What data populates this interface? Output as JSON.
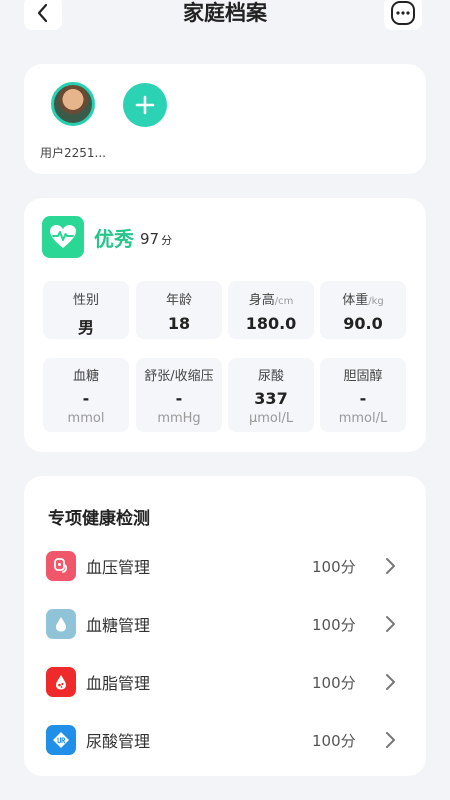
{
  "header": {
    "title": "家庭档案",
    "back_icon": "chevron-left-icon",
    "more_icon": "more-horizontal-icon"
  },
  "members": {
    "items": [
      {
        "name": "用户2251..."
      }
    ],
    "add_icon": "plus-icon",
    "accent": "#2bd2b3"
  },
  "health": {
    "rating": "优秀",
    "score": "97",
    "score_unit": "分",
    "rating_color": "#27c58a",
    "icon": "heart-pulse-icon",
    "basic": [
      {
        "label": "性别",
        "unit": "",
        "value": "男"
      },
      {
        "label": "年龄",
        "unit": "",
        "value": "18"
      },
      {
        "label": "身高",
        "unit": "/cm",
        "value": "180.0"
      },
      {
        "label": "体重",
        "unit": "/kg",
        "value": "90.0"
      }
    ],
    "labs": [
      {
        "label": "血糖",
        "value": "-",
        "unit": "mmol"
      },
      {
        "label": "舒张/收缩压",
        "value": "-",
        "unit": "mmHg"
      },
      {
        "label": "尿酸",
        "value": "337",
        "unit": "μmol/L"
      },
      {
        "label": "胆固醇",
        "value": "-",
        "unit": "mmol/L"
      }
    ]
  },
  "special": {
    "title": "专项健康检测",
    "items": [
      {
        "label": "血压管理",
        "score": "100分",
        "icon": "blood-pressure-icon",
        "color": "#f0576a"
      },
      {
        "label": "血糖管理",
        "score": "100分",
        "icon": "blood-sugar-drop-icon",
        "color": "#8fc3d8"
      },
      {
        "label": "血脂管理",
        "score": "100分",
        "icon": "blood-lipid-icon",
        "color": "#ee2a2a"
      },
      {
        "label": "尿酸管理",
        "score": "100分",
        "icon": "uric-acid-icon",
        "color": "#1f8fe8"
      }
    ]
  }
}
